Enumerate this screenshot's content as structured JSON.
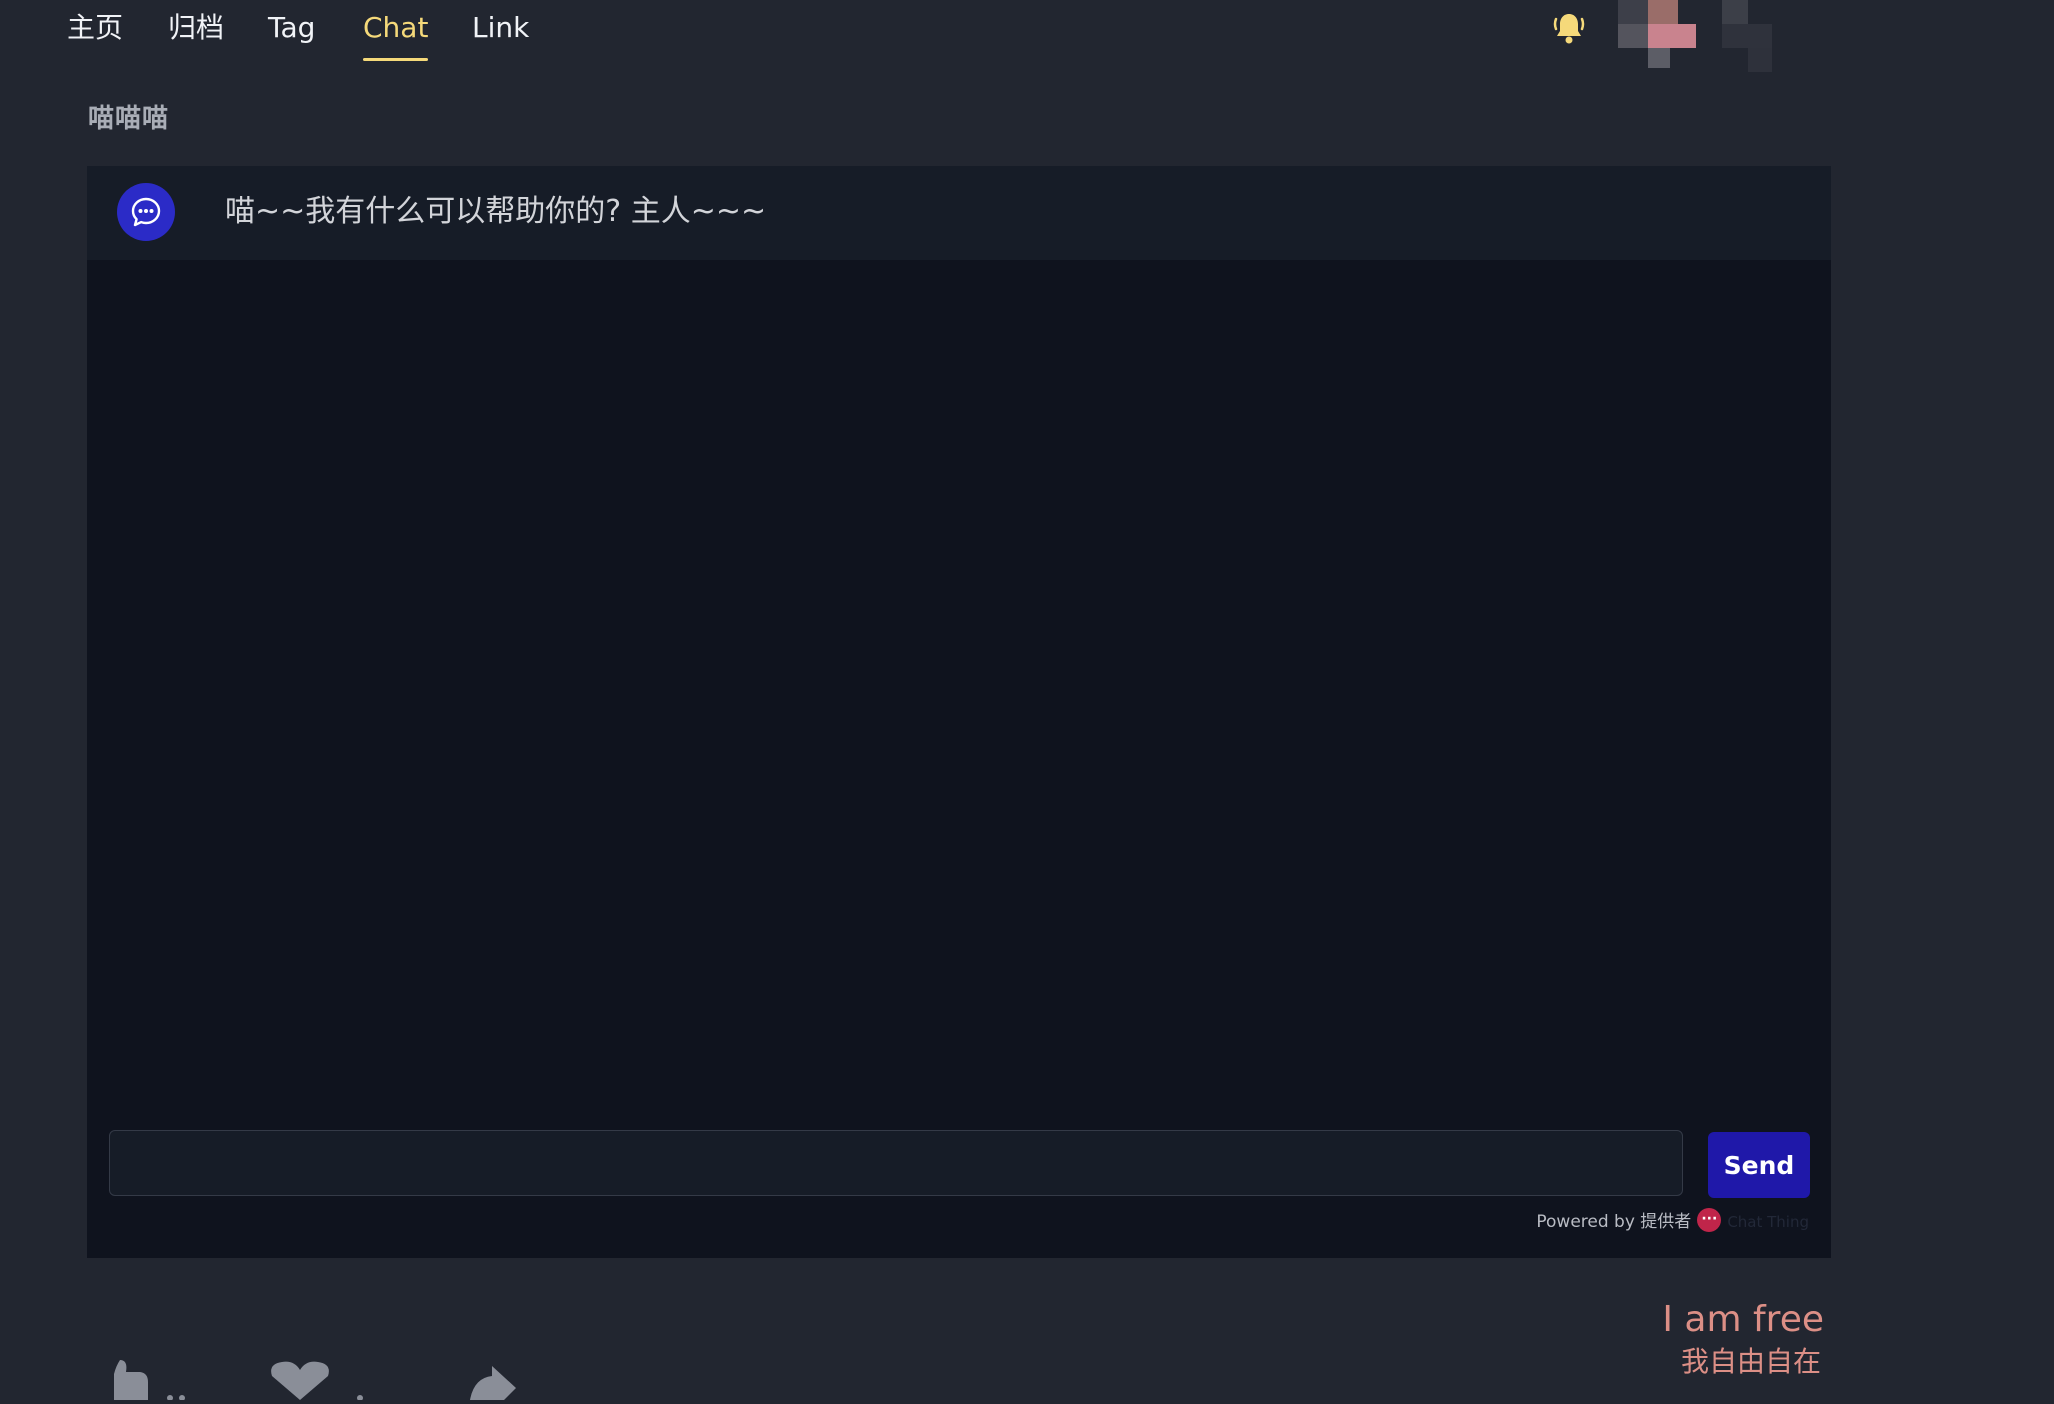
{
  "nav": {
    "items": [
      {
        "label": "主页"
      },
      {
        "label": "归档"
      },
      {
        "label": "Tag"
      },
      {
        "label": "Chat"
      },
      {
        "label": "Link"
      }
    ],
    "active_index": 3,
    "notification_icon": "bell-icon"
  },
  "page": {
    "title": "喵喵喵"
  },
  "chat": {
    "bot_icon": "chat-bubble-icon",
    "messages": [
      {
        "sender": "bot",
        "text": "喵~~我有什么可以帮助你的? 主人~~~"
      }
    ],
    "input": {
      "value": "",
      "placeholder": ""
    },
    "send_label": "Send",
    "powered_by": {
      "prefix": "Powered by 提供者",
      "brand": "Chat Thing"
    }
  },
  "footer": {
    "slogan_en": "I am free",
    "slogan_zh": "我自由自在",
    "icons": [
      "thumbs-up-icon",
      "heart-icon",
      "share-icon"
    ]
  },
  "colors": {
    "background": "#222630",
    "panel": "#0f131e",
    "accent": "#f5d97a",
    "send_button": "#1f18a9",
    "slogan": "#dc8f86"
  }
}
